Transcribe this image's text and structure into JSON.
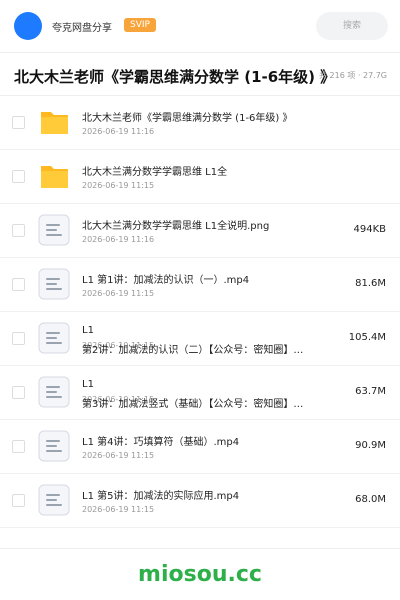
{
  "header": {
    "share_name": "夸克网盘分享",
    "badge": "SVIP",
    "search_placeholder": "搜索",
    "avatar_color": "#1e7bff",
    "badge_color": "#f7a43a"
  },
  "folder": {
    "title": "北大木兰老师《学霸思维满分数学 (1-6年级) 》",
    "summary": "共 216 项 · 27.7G"
  },
  "files": [
    {
      "type": "folder",
      "name": "北大木兰老师《学霸思维满分数学 (1-6年级) 》",
      "name2": "",
      "date": "2026-06-19 11:16",
      "size": ""
    },
    {
      "type": "folder",
      "name": "北大木兰满分数学学霸思维 L1全",
      "name2": "",
      "date": "2026-06-19 11:15",
      "size": ""
    },
    {
      "type": "file",
      "name": "北大木兰满分数学学霸思维 L1全说明.png",
      "name2": "",
      "date": "2026-06-19 11:16",
      "size": "494KB"
    },
    {
      "type": "file",
      "name": "L1 第1讲：加减法的认识（一）.mp4",
      "name2": "",
      "date": "2026-06-19 11:15",
      "size": "81.6M"
    },
    {
      "type": "file",
      "name": "L1",
      "name2": "第2讲：加减法的认识（二）【公众号：密知圈】…",
      "date": "2026-06-19 11:15",
      "size": "105.4M"
    },
    {
      "type": "file",
      "name": "L1",
      "name2": "第3讲：加减法竖式（基础）【公众号：密知圈】…",
      "date": "2026-06-19 11:15",
      "size": "63.7M"
    },
    {
      "type": "file",
      "name": "L1 第4讲：巧填算符（基础）.mp4",
      "name2": "",
      "date": "2026-06-19 11:15",
      "size": "90.9M"
    },
    {
      "type": "file",
      "name": "L1 第5讲：加减法的实际应用.mp4",
      "name2": "",
      "date": "2026-06-19 11:15",
      "size": "68.0M"
    }
  ],
  "footer": {
    "watermark": "miosou.cc",
    "color": "#2db04a"
  }
}
